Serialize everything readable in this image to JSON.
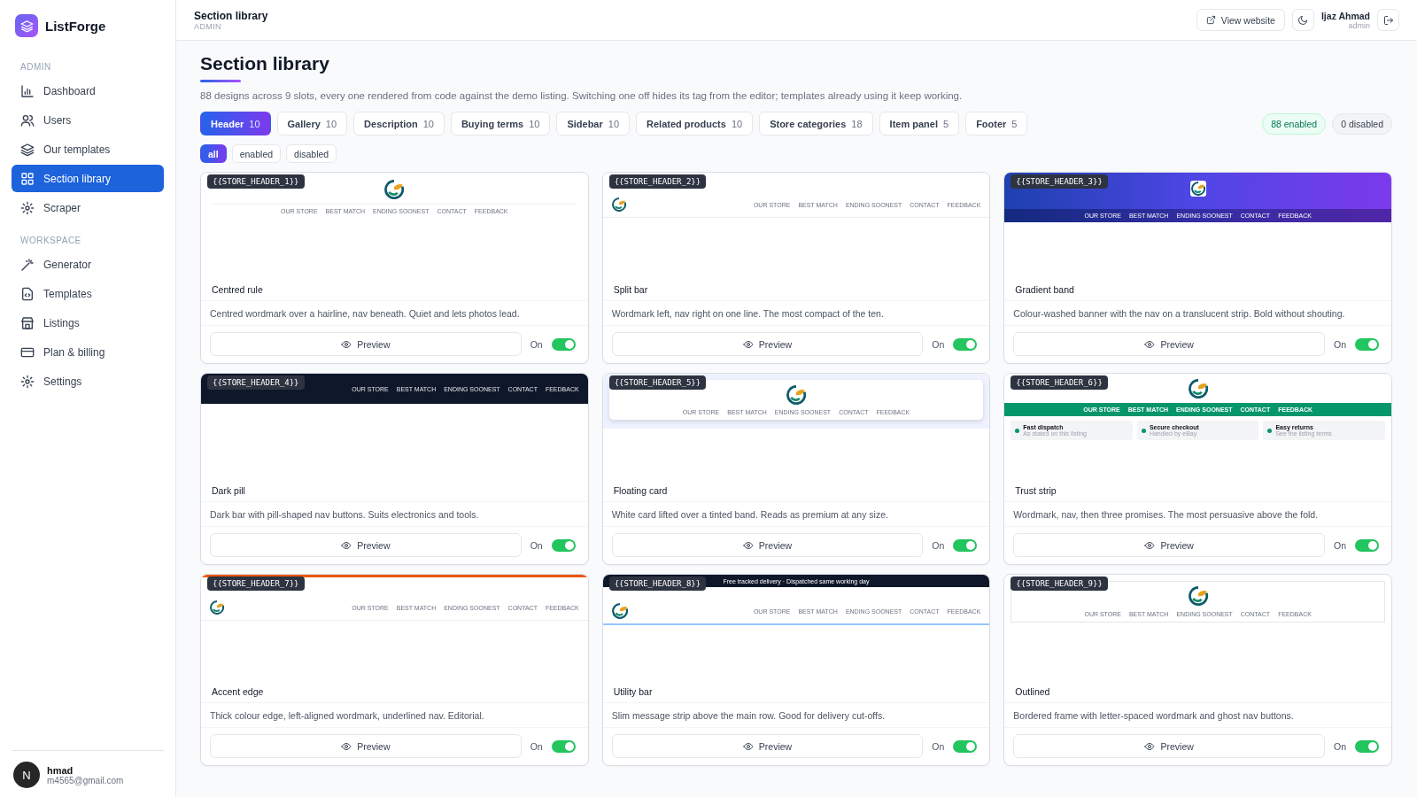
{
  "brand": {
    "name": "ListForge"
  },
  "sidebar": {
    "sections": [
      {
        "heading": "ADMIN",
        "items": [
          {
            "label": "Dashboard",
            "selected": false
          },
          {
            "label": "Users",
            "selected": false
          },
          {
            "label": "Our templates",
            "selected": false
          },
          {
            "label": "Section library",
            "selected": true
          },
          {
            "label": "Scraper",
            "selected": false
          }
        ]
      },
      {
        "heading": "WORKSPACE",
        "items": [
          {
            "label": "Generator",
            "selected": false
          },
          {
            "label": "Templates",
            "selected": false
          },
          {
            "label": "Listings",
            "selected": false
          },
          {
            "label": "Plan & billing",
            "selected": false
          },
          {
            "label": "Settings",
            "selected": false
          }
        ]
      }
    ],
    "user": {
      "avatar": "N",
      "name": "hmad",
      "email": "m4565@gmail.com"
    }
  },
  "topbar": {
    "title": "Section library",
    "subtitle": "ADMIN",
    "view_website": "View website",
    "user_name": "Ijaz Ahmad",
    "user_role": "admin"
  },
  "page": {
    "title": "Section library",
    "description": "88 designs across 9 slots, every one rendered from code against the demo listing. Switching one off hides its tag from the editor; templates already using it keep working."
  },
  "slots": [
    {
      "label": "Header",
      "count": "10",
      "selected": true
    },
    {
      "label": "Gallery",
      "count": "10",
      "selected": false
    },
    {
      "label": "Description",
      "count": "10",
      "selected": false
    },
    {
      "label": "Buying terms",
      "count": "10",
      "selected": false
    },
    {
      "label": "Sidebar",
      "count": "10",
      "selected": false
    },
    {
      "label": "Related products",
      "count": "10",
      "selected": false
    },
    {
      "label": "Store categories",
      "count": "18",
      "selected": false
    },
    {
      "label": "Item panel",
      "count": "5",
      "selected": false
    },
    {
      "label": "Footer",
      "count": "5",
      "selected": false
    }
  ],
  "totals": {
    "enabled": "88 enabled",
    "disabled": "0 disabled"
  },
  "filters": [
    {
      "label": "all",
      "selected": true
    },
    {
      "label": "enabled",
      "selected": false
    },
    {
      "label": "disabled",
      "selected": false
    }
  ],
  "cards": [
    {
      "kind": "centred",
      "tag": "{{STORE_HEADER_1}}",
      "nav": [
        "OUR STORE",
        "BEST MATCH",
        "ENDING SOONEST",
        "CONTACT",
        "FEEDBACK"
      ],
      "title": "Centred rule",
      "description": "Centred wordmark over a hairline, nav beneath. Quiet and lets photos lead.",
      "preview": "Preview",
      "toggle_label": "On",
      "on": true
    },
    {
      "kind": "split",
      "tag": "{{STORE_HEADER_2}}",
      "nav": [
        "OUR STORE",
        "BEST MATCH",
        "ENDING SOONEST",
        "CONTACT",
        "FEEDBACK"
      ],
      "title": "Split bar",
      "description": "Wordmark left, nav right on one line. The most compact of the ten.",
      "preview": "Preview",
      "toggle_label": "On",
      "on": true
    },
    {
      "kind": "gradient",
      "tag": "{{STORE_HEADER_3}}",
      "nav": [
        "OUR STORE",
        "BEST MATCH",
        "ENDING SOONEST",
        "CONTACT",
        "FEEDBACK"
      ],
      "title": "Gradient band",
      "description": "Colour-washed banner with the nav on a translucent strip. Bold without shouting.",
      "preview": "Preview",
      "toggle_label": "On",
      "on": true
    },
    {
      "kind": "dark",
      "tag": "{{STORE_HEADER_4}}",
      "nav": [
        "OUR STORE",
        "BEST MATCH",
        "ENDING SOONEST",
        "CONTACT",
        "FEEDBACK"
      ],
      "title": "Dark pill",
      "description": "Dark bar with pill-shaped nav buttons. Suits electronics and tools.",
      "preview": "Preview",
      "toggle_label": "On",
      "on": true
    },
    {
      "kind": "floating",
      "tag": "{{STORE_HEADER_5}}",
      "nav": [
        "OUR STORE",
        "BEST MATCH",
        "ENDING SOONEST",
        "CONTACT",
        "FEEDBACK"
      ],
      "title": "Floating card",
      "description": "White card lifted over a tinted band. Reads as premium at any size.",
      "preview": "Preview",
      "toggle_label": "On",
      "on": true
    },
    {
      "kind": "trust",
      "tag": "{{STORE_HEADER_6}}",
      "nav": [
        "OUR STORE",
        "BEST MATCH",
        "ENDING SOONEST",
        "CONTACT",
        "FEEDBACK"
      ],
      "promises": [
        {
          "title": "Fast dispatch",
          "text": "As stated on this listing"
        },
        {
          "title": "Secure checkout",
          "text": "Handled by eBay"
        },
        {
          "title": "Easy returns",
          "text": "See the listing terms"
        }
      ],
      "title": "Trust strip",
      "description": "Wordmark, nav, then three promises. The most persuasive above the fold.",
      "preview": "Preview",
      "toggle_label": "On",
      "on": true
    },
    {
      "kind": "accent",
      "tag": "{{STORE_HEADER_7}}",
      "nav": [
        "OUR STORE",
        "BEST MATCH",
        "ENDING SOONEST",
        "CONTACT",
        "FEEDBACK"
      ],
      "title": "Accent edge",
      "description": "Thick colour edge, left-aligned wordmark, underlined nav. Editorial.",
      "preview": "Preview",
      "toggle_label": "On",
      "on": true
    },
    {
      "kind": "utility",
      "tag": "{{STORE_HEADER_8}}",
      "message": "Free tracked delivery · Dispatched same working day",
      "nav": [
        "OUR STORE",
        "BEST MATCH",
        "ENDING SOONEST",
        "CONTACT",
        "FEEDBACK"
      ],
      "title": "Utility bar",
      "description": "Slim message strip above the main row. Good for delivery cut-offs.",
      "preview": "Preview",
      "toggle_label": "On",
      "on": true
    },
    {
      "kind": "outlined",
      "tag": "{{STORE_HEADER_9}}",
      "nav": [
        "OUR STORE",
        "BEST MATCH",
        "ENDING SOONEST",
        "CONTACT",
        "FEEDBACK"
      ],
      "title": "Outlined",
      "description": "Bordered frame with letter-spaced wordmark and ghost nav buttons.",
      "preview": "Preview",
      "toggle_label": "On",
      "on": true
    }
  ]
}
